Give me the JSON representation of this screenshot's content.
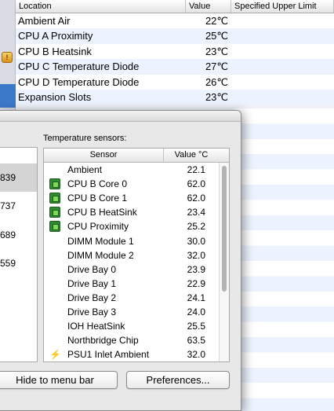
{
  "background_table": {
    "columns": [
      "Location",
      "Value",
      "Specified Upper Limit"
    ],
    "rows": [
      {
        "location": "Ambient Air",
        "value": "22℃"
      },
      {
        "location": "CPU A Proximity",
        "value": "25℃"
      },
      {
        "location": "CPU B Heatsink",
        "value": "23℃"
      },
      {
        "location": "CPU C Temperature Diode",
        "value": "27℃"
      },
      {
        "location": "CPU D Temperature Diode",
        "value": "26℃"
      },
      {
        "location": "Expansion Slots",
        "value": "23℃"
      }
    ]
  },
  "left_list": {
    "items": [
      {
        "label": "839",
        "selected": true
      },
      {
        "label": "737",
        "selected": false
      },
      {
        "label": "689",
        "selected": false
      },
      {
        "label": "559",
        "selected": false
      }
    ]
  },
  "sensors": {
    "section_label": "Temperature sensors:",
    "columns": {
      "sensor": "Sensor",
      "value": "Value °C"
    },
    "rows": [
      {
        "name": "Ambient",
        "value": "22.1",
        "icon": "none"
      },
      {
        "name": "CPU B Core 0",
        "value": "62.0",
        "icon": "cpu-chip-icon"
      },
      {
        "name": "CPU B Core 1",
        "value": "62.0",
        "icon": "cpu-chip-icon"
      },
      {
        "name": "CPU B HeatSink",
        "value": "23.4",
        "icon": "cpu-chip-icon"
      },
      {
        "name": "CPU Proximity",
        "value": "25.2",
        "icon": "cpu-chip-icon"
      },
      {
        "name": "DIMM Module 1",
        "value": "30.0",
        "icon": "none"
      },
      {
        "name": "DIMM Module 2",
        "value": "32.0",
        "icon": "none"
      },
      {
        "name": "Drive Bay 0",
        "value": "23.9",
        "icon": "none"
      },
      {
        "name": "Drive Bay 1",
        "value": "22.9",
        "icon": "none"
      },
      {
        "name": "Drive Bay 2",
        "value": "24.1",
        "icon": "none"
      },
      {
        "name": "Drive Bay 3",
        "value": "24.0",
        "icon": "none"
      },
      {
        "name": "IOH HeatSink",
        "value": "25.5",
        "icon": "none"
      },
      {
        "name": "Northbridge Chip",
        "value": "63.5",
        "icon": "none"
      },
      {
        "name": "PSU1 Inlet Ambient",
        "value": "32.0",
        "icon": "lightning-bolt-icon"
      }
    ]
  },
  "buttons": {
    "hide": "Hide to menu bar",
    "preferences": "Preferences..."
  },
  "colors": {
    "chip_green": "#2f8a32",
    "selection_blue": "#3c78c8",
    "bolt_yellow": "#e0b000"
  }
}
